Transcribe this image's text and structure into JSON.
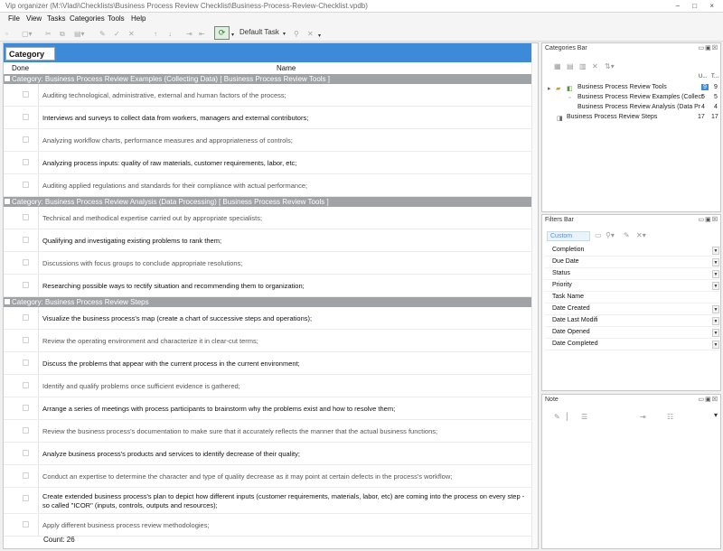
{
  "window": {
    "title": "Vip organizer (M:\\Vladi\\Checklists\\Business Process Review Checklist\\Business-Process-Review-Checklist.vpdb)",
    "controls": "– □ ×"
  },
  "menu": [
    "File",
    "View",
    "Tasks",
    "Categories",
    "Tools",
    "Help"
  ],
  "toolbar": {
    "task_selector": "Default Task"
  },
  "main": {
    "tab_label": "Category",
    "col_done": "Done",
    "col_name": "Name",
    "groups": [
      {
        "label": "Category: Business Process Review Examples (Collecting Data)    [ Business Process Review Tools ]",
        "tasks": [
          "Auditing technological, administrative, external and human factors of the process;",
          "Interviews and surveys to collect data from workers, managers and external contributors;",
          "Analyzing workflow charts, performance measures and appropriateness of controls;",
          "Analyzing process inputs: quality of raw materials, customer requirements, labor, etc;",
          "Auditing applied regulations and standards for their compliance with actual performance;"
        ]
      },
      {
        "label": "Category: Business Process Review Analysis (Data Processing)    [ Business Process Review Tools ]",
        "tasks": [
          "Technical and methodical expertise carried out by appropriate specialists;",
          "Qualifying and investigating existing problems to rank them;",
          "Discussions with focus groups to conclude appropriate resolutions;",
          "Researching possible ways to rectify situation and recommending them to organization;"
        ]
      },
      {
        "label": "Category: Business Process Review Steps",
        "tasks": [
          "Visualize the business process's map (create a chart of successive steps and operations);",
          "Review the operating environment and characterize it in clear-cut terms;",
          "Discuss the problems that appear with the current process in the current environment;",
          "Identify and qualify problems once sufficient evidence is gathered;",
          "Arrange a series of meetings with process participants to brainstorm why the problems exist and how to resolve them;",
          "Review the business process's documentation to make sure that it accurately reflects the manner that the actual business functions;",
          "Analyze business process's products and services to identify decrease of their quality;",
          "Conduct an expertise to determine the character and type of quality decrease as it may point at certain defects in the process's workflow;",
          "Create extended business process's plan to depict how different inputs (customer requirements, materials, labor, etc) are coming into the process on every step - so called \"ICOR\" (inputs, controls, outputs and resources);",
          "Apply different business process review methodologies;"
        ]
      }
    ],
    "count_label": "Count: 26"
  },
  "categories_bar": {
    "title": "Categories Bar",
    "col1": "U...",
    "col2": "T...",
    "items": [
      {
        "label": "Business Process Review Tools",
        "a": "9",
        "b": "9"
      },
      {
        "label": "Business Process Review Examples (Collect",
        "a": "5",
        "b": "5"
      },
      {
        "label": "Business Process Review Analysis (Data Pr",
        "a": "4",
        "b": "4"
      },
      {
        "label": "Business Process Review Steps",
        "a": "17",
        "b": "17"
      }
    ]
  },
  "filters_bar": {
    "title": "Filters Bar",
    "preset": "Custom",
    "fields": [
      "Completion",
      "Due Date",
      "Status",
      "Priority",
      "Task Name",
      "Date Created",
      "Date Last Modifi",
      "Date Opened",
      "Date Completed"
    ]
  },
  "note": {
    "title": "Note"
  }
}
